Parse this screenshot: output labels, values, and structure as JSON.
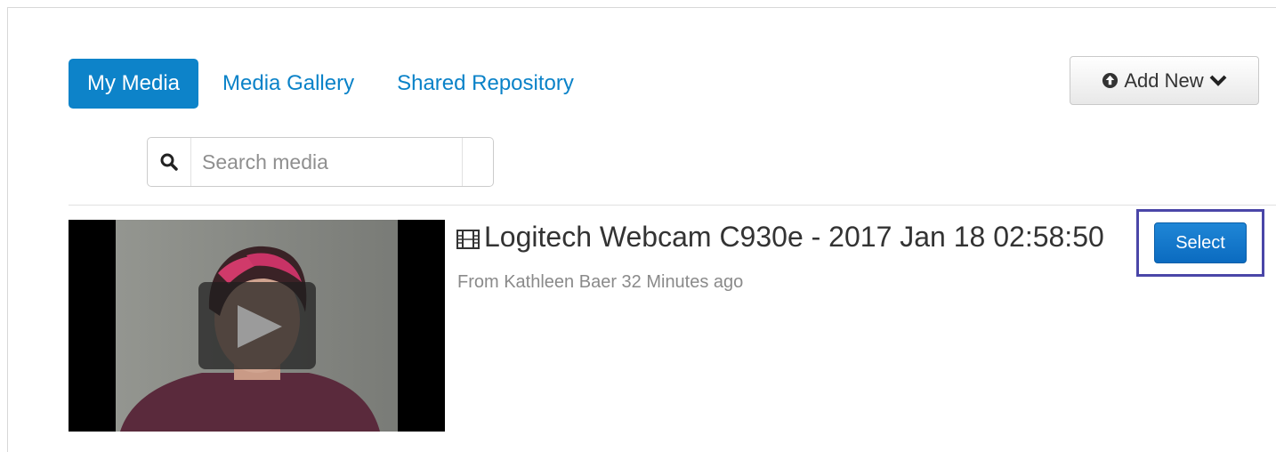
{
  "tabs": [
    {
      "label": "My Media",
      "active": true
    },
    {
      "label": "Media Gallery",
      "active": false
    },
    {
      "label": "Shared Repository",
      "active": false
    }
  ],
  "add_new": {
    "label": "Add New",
    "icon_left": "arrow-circle-up-icon",
    "icon_right": "chevron-down-icon"
  },
  "search": {
    "placeholder": "Search media",
    "value": "",
    "icon": "search-icon"
  },
  "entry": {
    "type_icon": "film-icon",
    "title": "Logitech Webcam C930e - 2017 Jan 18 02:58:50",
    "meta": "From Kathleen Baer 32 Minutes ago",
    "select_label": "Select"
  },
  "colors": {
    "accent": "#0d83c9",
    "link": "#0a82c8",
    "select_button": "#0b6bc0",
    "highlight_frame": "#4a46a8"
  }
}
